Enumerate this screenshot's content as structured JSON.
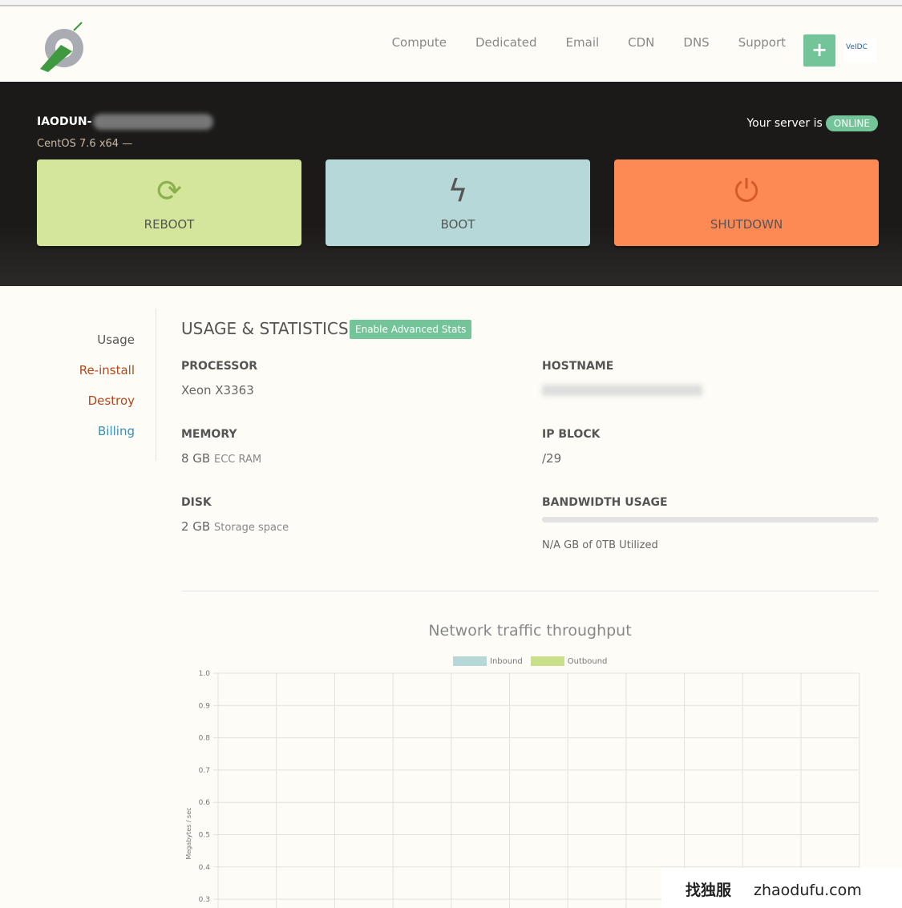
{
  "nav": {
    "links": [
      "Compute",
      "Dedicated",
      "Email",
      "CDN",
      "DNS",
      "Support"
    ],
    "plus": "+",
    "partner_logo": "VeIDC"
  },
  "server": {
    "name": "IAODUN-",
    "os": "CentOS 7.6 x64 — ",
    "status_prefix": "Your server is",
    "status": "ONLINE"
  },
  "actions": {
    "reboot": "REBOOT",
    "boot": "BOOT",
    "shutdown": "SHUTDOWN"
  },
  "sidebar": [
    {
      "label": "Usage",
      "color": "#555555"
    },
    {
      "label": "Re-install",
      "color": "#b5451b"
    },
    {
      "label": "Destroy",
      "color": "#b5451b"
    },
    {
      "label": "Billing",
      "color": "#3a8fb7"
    }
  ],
  "main": {
    "title": "USAGE & STATISTICS",
    "advanced": "Enable Advanced Stats",
    "processor_label": "PROCESSOR",
    "processor": "Xeon X3363",
    "hostname_label": "HOSTNAME",
    "memory_label": "MEMORY",
    "memory": "8 GB",
    "memory_unit": "ECC RAM",
    "ipblock_label": "IP BLOCK",
    "ipblock": "/29",
    "disk_label": "DISK",
    "disk": "2 GB",
    "disk_unit": "Storage space",
    "bw_label": "BANDWIDTH USAGE",
    "bw_text": "N/A GB of 0TB Utilized",
    "bw_percent": 0
  },
  "chart_data": {
    "type": "line",
    "title": "Network traffic throughput",
    "ylabel": "Megabytes / sec",
    "ylim": [
      0.3,
      1.0
    ],
    "yticks": [
      "1.0",
      "0.9",
      "0.8",
      "0.7",
      "0.6",
      "0.5",
      "0.4",
      "0.3"
    ],
    "grid": true,
    "legend": "top",
    "series": [
      {
        "name": "Inbound",
        "color": "#b7d8d8",
        "values": []
      },
      {
        "name": "Outbound",
        "color": "#c9df8a",
        "values": []
      }
    ]
  },
  "watermark": {
    "cn": "找独服",
    "en": "zhaodufu.com"
  }
}
